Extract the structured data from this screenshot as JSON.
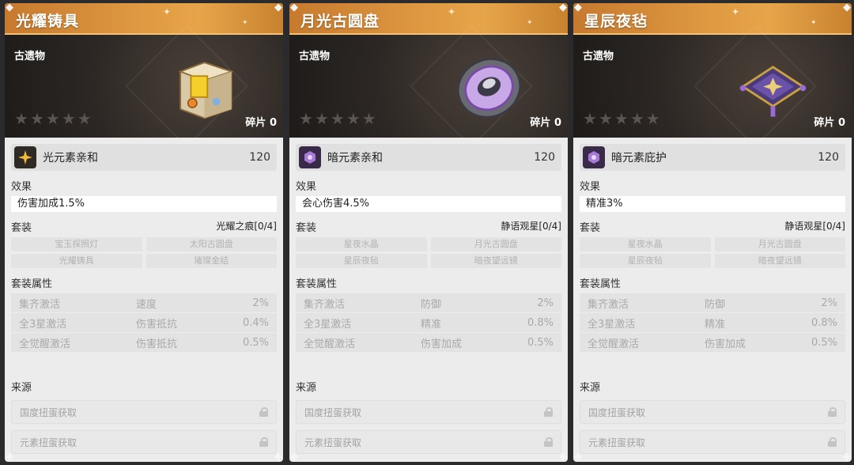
{
  "cards": [
    {
      "name": "光耀铸具",
      "category": "古遗物",
      "shards": "碎片 0",
      "art_icon": "golden-chest-icon",
      "affinity": {
        "icon": "light-element-icon",
        "color": "#2e2a26",
        "name": "光元素亲和",
        "value": "120"
      },
      "effect_label": "效果",
      "effect": "伤害加成1.5%",
      "set_label": "套装",
      "set_name": "光耀之痕[0/4]",
      "set_pieces": [
        "宝玉探照灯",
        "太阳古圆盘",
        "光耀铸具",
        "璀璨金结"
      ],
      "attr_label": "套装属性",
      "attrs": [
        {
          "cond": "集齐激活",
          "stat": "速度",
          "val": "2%"
        },
        {
          "cond": "全3星激活",
          "stat": "伤害抵抗",
          "val": "0.4%"
        },
        {
          "cond": "全觉醒激活",
          "stat": "伤害抵抗",
          "val": "0.5%"
        }
      ],
      "source_label": "来源",
      "sources": [
        "国度扭蛋获取",
        "元素扭蛋获取"
      ]
    },
    {
      "name": "月光古圆盘",
      "category": "古遗物",
      "shards": "碎片 0",
      "art_icon": "moon-disc-icon",
      "affinity": {
        "icon": "dark-element-icon",
        "color": "#3a2a4a",
        "name": "暗元素亲和",
        "value": "120"
      },
      "effect_label": "效果",
      "effect": "会心伤害4.5%",
      "set_label": "套装",
      "set_name": "静语观星[0/4]",
      "set_pieces": [
        "星夜水晶",
        "月光古圆盘",
        "星辰夜毡",
        "暗夜望远镜"
      ],
      "attr_label": "套装属性",
      "attrs": [
        {
          "cond": "集齐激活",
          "stat": "防御",
          "val": "2%"
        },
        {
          "cond": "全3星激活",
          "stat": "精准",
          "val": "0.8%"
        },
        {
          "cond": "全觉醒激活",
          "stat": "伤害加成",
          "val": "0.5%"
        }
      ],
      "source_label": "来源",
      "sources": [
        "国度扭蛋获取",
        "元素扭蛋获取"
      ]
    },
    {
      "name": "星辰夜毡",
      "category": "古遗物",
      "shards": "碎片 0",
      "art_icon": "star-cushion-icon",
      "affinity": {
        "icon": "dark-element-icon",
        "color": "#3a2a4a",
        "name": "暗元素庇护",
        "value": "120"
      },
      "effect_label": "效果",
      "effect": "精准3%",
      "set_label": "套装",
      "set_name": "静语观星[0/4]",
      "set_pieces": [
        "星夜水晶",
        "月光古圆盘",
        "星辰夜毡",
        "暗夜望远镜"
      ],
      "attr_label": "套装属性",
      "attrs": [
        {
          "cond": "集齐激活",
          "stat": "防御",
          "val": "2%"
        },
        {
          "cond": "全3星激活",
          "stat": "精准",
          "val": "0.8%"
        },
        {
          "cond": "全觉醒激活",
          "stat": "伤害加成",
          "val": "0.5%"
        }
      ],
      "source_label": "来源",
      "sources": [
        "国度扭蛋获取",
        "元素扭蛋获取"
      ]
    }
  ]
}
